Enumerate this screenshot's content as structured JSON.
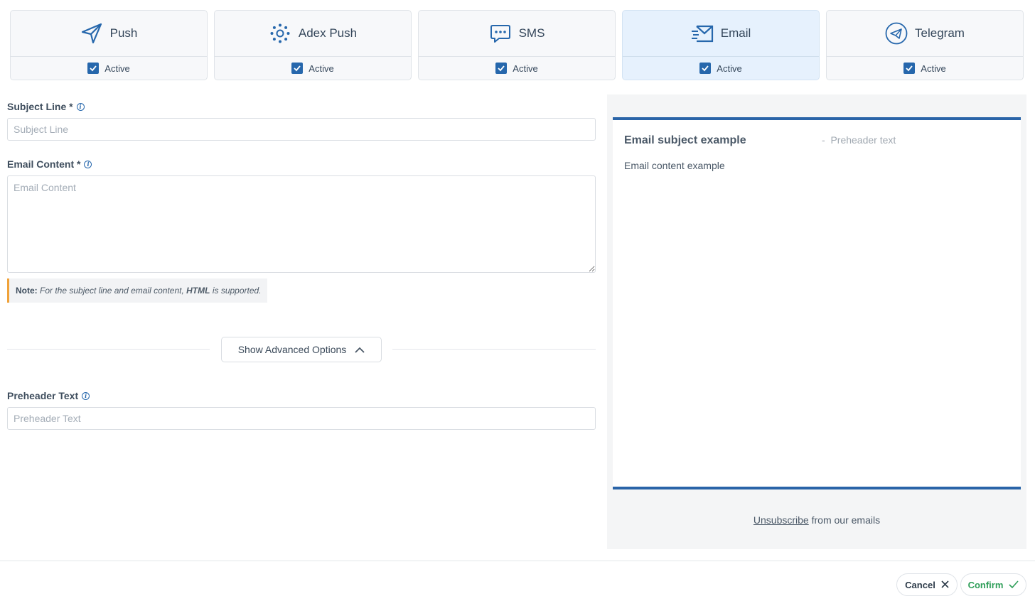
{
  "channels": [
    {
      "name": "Push",
      "icon": "paper-plane-icon",
      "active_label": "Active",
      "checked": true
    },
    {
      "name": "Adex Push",
      "icon": "sparkle-icon",
      "active_label": "Active",
      "checked": true
    },
    {
      "name": "SMS",
      "icon": "chat-bubble-icon",
      "active_label": "Active",
      "checked": true
    },
    {
      "name": "Email",
      "icon": "envelope-icon",
      "active_label": "Active",
      "checked": true,
      "selected": true
    },
    {
      "name": "Telegram",
      "icon": "telegram-icon",
      "active_label": "Active",
      "checked": true
    }
  ],
  "form": {
    "subject_label": "Subject Line *",
    "subject_placeholder": "Subject Line",
    "subject_value": "",
    "content_label": "Email Content *",
    "content_placeholder": "Email Content",
    "content_value": "",
    "note": {
      "prefix": "Note:",
      "text_before": "For the subject line and email content,",
      "highlight": "HTML",
      "text_after": "is supported."
    },
    "advanced_button": "Show Advanced Options",
    "preheader_label": "Preheader Text",
    "preheader_placeholder": "Preheader Text",
    "preheader_value": ""
  },
  "preview": {
    "subject": "Email subject example",
    "preheader_separator": "-",
    "preheader": "Preheader text",
    "content": "Email content example",
    "unsubscribe_link": "Unsubscribe",
    "unsubscribe_text": "from our emails"
  },
  "footer": {
    "cancel_label": "Cancel",
    "confirm_label": "Confirm"
  },
  "colors": {
    "accent": "#2667ac",
    "preview_border": "#2a64a8",
    "note_bar": "#f0a23a",
    "confirm": "#2e9e58",
    "selected_bg": "#e6f1fd"
  }
}
